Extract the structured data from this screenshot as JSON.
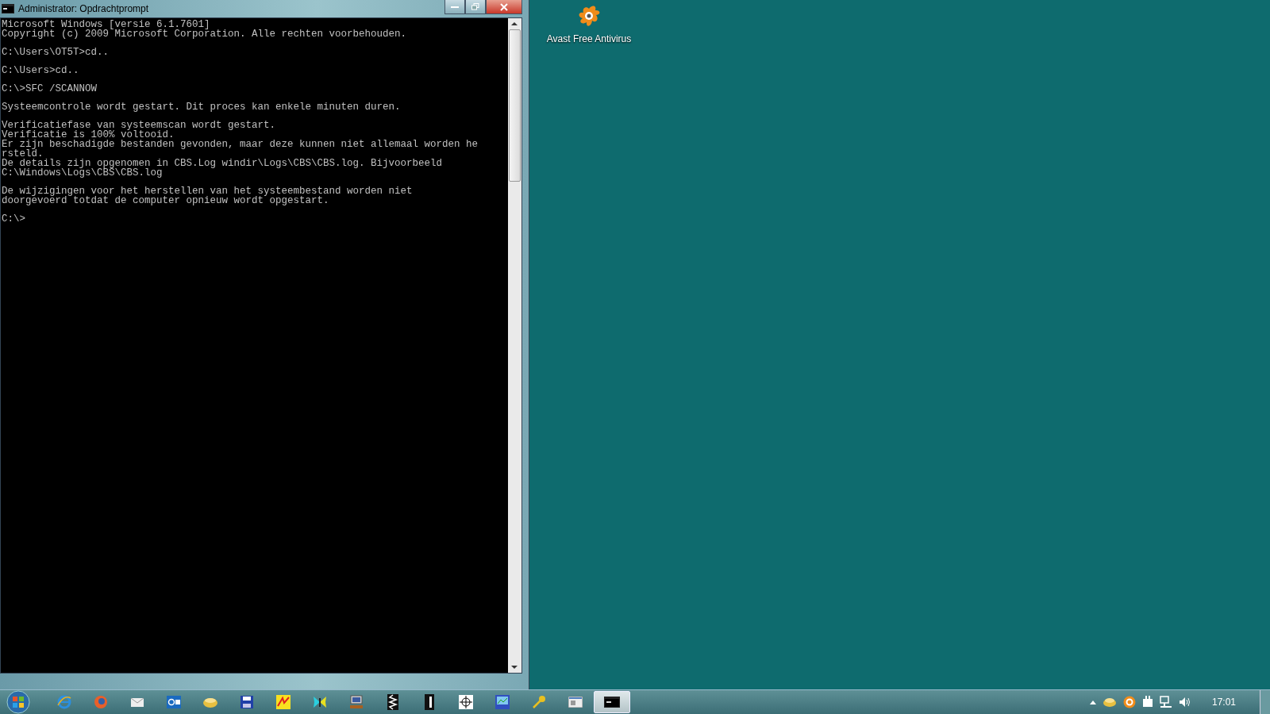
{
  "window": {
    "title": "Administrator: Opdrachtprompt",
    "console_blocks": [
      [
        "Microsoft Windows [versie 6.1.7601]",
        "Copyright (c) 2009 Microsoft Corporation. Alle rechten voorbehouden."
      ],
      [
        "C:\\Users\\OT5T>cd.."
      ],
      [
        "C:\\Users>cd.."
      ],
      [
        "C:\\>SFC /SCANNOW"
      ],
      [
        "Systeemcontrole wordt gestart. Dit proces kan enkele minuten duren."
      ],
      [
        "Verificatiefase van systeemscan wordt gestart.",
        "Verificatie is 100% voltooid.",
        "Er zijn beschadigde bestanden gevonden, maar deze kunnen niet allemaal worden he",
        "rsteld.",
        "De details zijn opgenomen in CBS.Log windir\\Logs\\CBS\\CBS.log. Bijvoorbeeld",
        "C:\\Windows\\Logs\\CBS\\CBS.log"
      ],
      [
        "De wijzigingen voor het herstellen van het systeembestand worden niet",
        "doorgevoerd totdat de computer opnieuw wordt opgestart."
      ],
      [
        "C:\\>"
      ]
    ]
  },
  "desktop_icons": [
    {
      "label": "Avast Free Antivirus"
    }
  ],
  "taskbar": {
    "items": [
      {
        "kind": "ie",
        "selected": false
      },
      {
        "kind": "firefox",
        "selected": false
      },
      {
        "kind": "mail",
        "selected": false
      },
      {
        "kind": "outlook",
        "selected": false
      },
      {
        "kind": "drive",
        "selected": false
      },
      {
        "kind": "floppy",
        "selected": false
      },
      {
        "kind": "paint",
        "selected": false
      },
      {
        "kind": "butterfly",
        "selected": false
      },
      {
        "kind": "computer",
        "selected": false
      },
      {
        "kind": "zip",
        "selected": false
      },
      {
        "kind": "book",
        "selected": false
      },
      {
        "kind": "target",
        "selected": false
      },
      {
        "kind": "chart",
        "selected": false
      },
      {
        "kind": "key",
        "selected": false
      },
      {
        "kind": "window",
        "selected": false
      },
      {
        "kind": "console",
        "selected": true
      }
    ],
    "clock": "17:01"
  }
}
